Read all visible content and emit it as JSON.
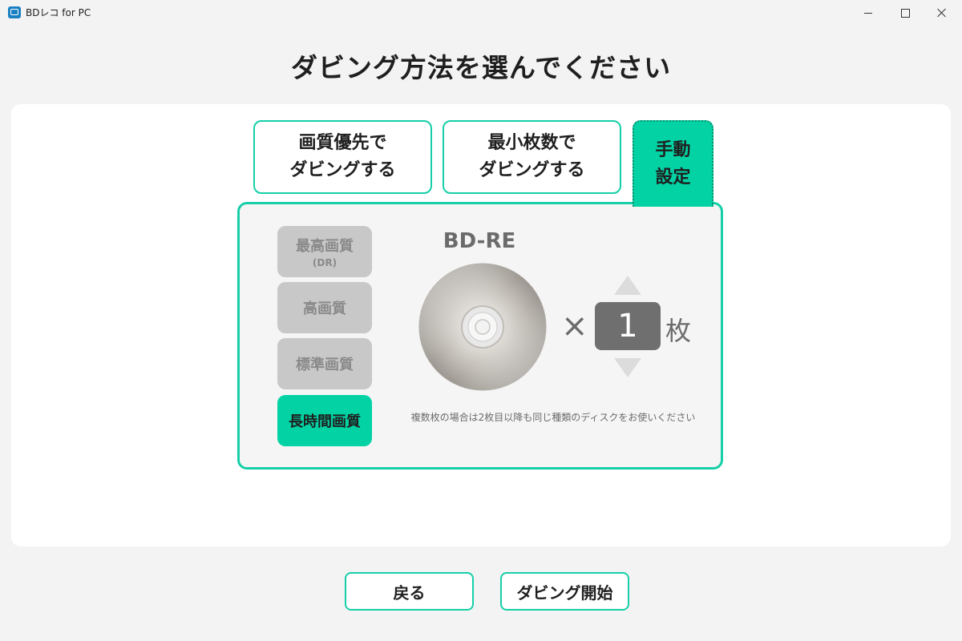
{
  "window": {
    "title": "BDレコ for PC",
    "controls": {
      "minimize": "minimize",
      "maximize": "maximize",
      "close": "close"
    }
  },
  "page": {
    "title": "ダビング方法を選んでください"
  },
  "tabs": [
    {
      "line1": "画質優先で",
      "line2": "ダビングする",
      "selected": false
    },
    {
      "line1": "最小枚数で",
      "line2": "ダビングする",
      "selected": false
    },
    {
      "line1": "手動",
      "line2": "設定",
      "selected": true
    }
  ],
  "quality_options": [
    {
      "label": "最高画質",
      "sub": "(DR)",
      "selected": false
    },
    {
      "label": "高画質",
      "sub": "",
      "selected": false
    },
    {
      "label": "標準画質",
      "sub": "",
      "selected": false
    },
    {
      "label": "長時間画質",
      "sub": "",
      "selected": true
    }
  ],
  "disc": {
    "type_label": "BD-RE",
    "multiplier": "×",
    "count": "1",
    "unit": "枚",
    "note": "複数枚の場合は2枚目以降も同じ種類のディスクをお使いください"
  },
  "actions": {
    "back": "戻る",
    "start": "ダビング開始"
  },
  "colors": {
    "accent": "#03d3a4",
    "accent_border": "#16cfa8",
    "disabled_bg": "#c8c8c8",
    "count_bg": "#6f6f6f"
  }
}
